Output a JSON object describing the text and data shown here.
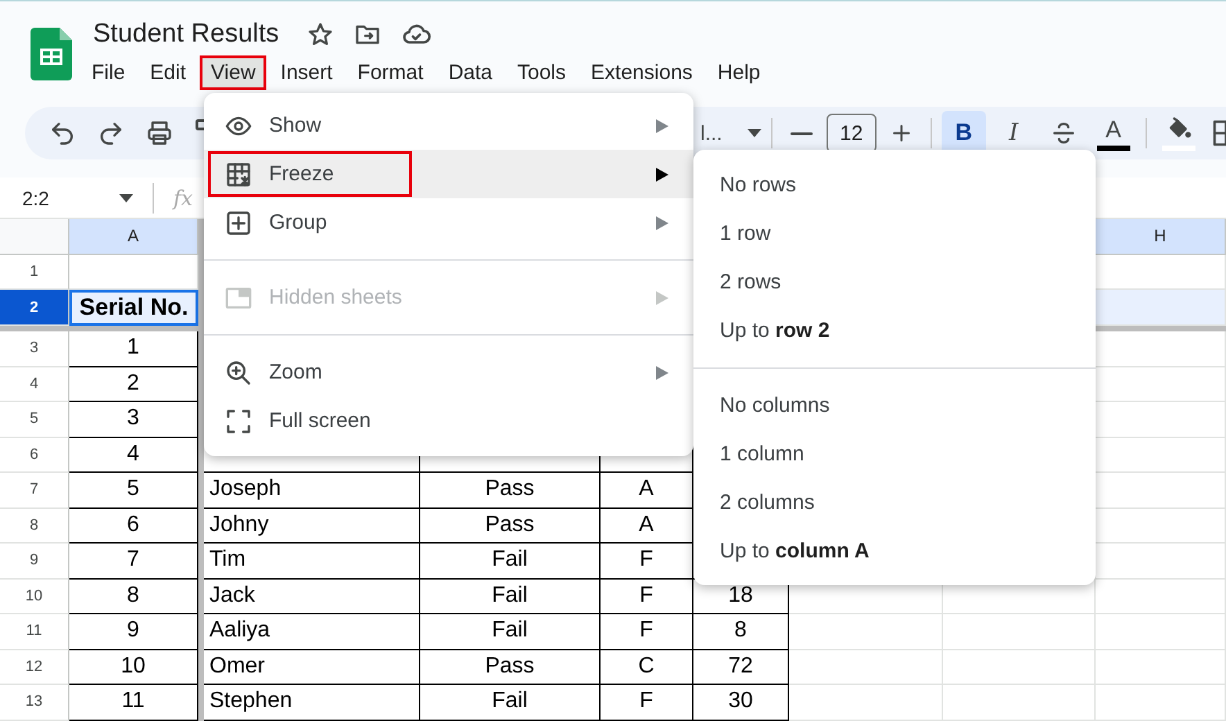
{
  "document": {
    "title": "Student Results"
  },
  "menu_bar": [
    {
      "label": "File",
      "selected": false,
      "outlined": false
    },
    {
      "label": "Edit",
      "selected": false,
      "outlined": false
    },
    {
      "label": "View",
      "selected": true,
      "outlined": true
    },
    {
      "label": "Insert",
      "selected": false,
      "outlined": false
    },
    {
      "label": "Format",
      "selected": false,
      "outlined": false
    },
    {
      "label": "Data",
      "selected": false,
      "outlined": false
    },
    {
      "label": "Tools",
      "selected": false,
      "outlined": false
    },
    {
      "label": "Extensions",
      "selected": false,
      "outlined": false
    },
    {
      "label": "Help",
      "selected": false,
      "outlined": false
    }
  ],
  "toolbar": {
    "font_name": "l...",
    "font_size": "12",
    "format_buttons": [
      {
        "kind": "bold",
        "glyph": "B",
        "selected": true
      },
      {
        "kind": "italic",
        "glyph": "I",
        "selected": false
      },
      {
        "kind": "strikethrough",
        "selected": false
      },
      {
        "kind": "text_color",
        "glyph": "A",
        "selected": false
      }
    ]
  },
  "formula_bar": {
    "name_box": "2:2",
    "formula_icon": "fx"
  },
  "sheet": {
    "columns": [
      {
        "label": "A"
      },
      {
        "label": "H"
      }
    ],
    "rows": [
      {
        "number": "1",
        "selected": false,
        "bordered": false
      },
      {
        "number": "2",
        "selected": true,
        "bordered": false,
        "cells": {
          "A": "Serial No."
        }
      },
      {
        "number": "3",
        "selected": false,
        "bordered": true,
        "cells": {
          "A": "1"
        }
      },
      {
        "number": "4",
        "selected": false,
        "bordered": true,
        "cells": {
          "A": "2"
        }
      },
      {
        "number": "5",
        "selected": false,
        "bordered": true,
        "cells": {
          "A": "3"
        }
      },
      {
        "number": "6",
        "selected": false,
        "bordered": true,
        "cells": {
          "A": "4"
        }
      },
      {
        "number": "7",
        "selected": false,
        "bordered": true,
        "cells": {
          "A": "5",
          "B": "Joseph",
          "C": "Pass",
          "D": "A"
        }
      },
      {
        "number": "8",
        "selected": false,
        "bordered": true,
        "cells": {
          "A": "6",
          "B": "Johny",
          "C": "Pass",
          "D": "A"
        }
      },
      {
        "number": "9",
        "selected": false,
        "bordered": true,
        "cells": {
          "A": "7",
          "B": "Tim",
          "C": "Fail",
          "D": "F"
        }
      },
      {
        "number": "10",
        "selected": false,
        "bordered": true,
        "cells": {
          "A": "8",
          "B": "Jack",
          "C": "Fail",
          "D": "F",
          "E": "18"
        }
      },
      {
        "number": "11",
        "selected": false,
        "bordered": true,
        "cells": {
          "A": "9",
          "B": "Aaliya",
          "C": "Fail",
          "D": "F",
          "E": "8"
        }
      },
      {
        "number": "12",
        "selected": false,
        "bordered": true,
        "cells": {
          "A": "10",
          "B": "Omer",
          "C": "Pass",
          "D": "C",
          "E": "72"
        }
      },
      {
        "number": "13",
        "selected": false,
        "bordered": true,
        "cells": {
          "A": "11",
          "B": "Stephen",
          "C": "Fail",
          "D": "F",
          "E": "30"
        }
      }
    ]
  },
  "view_menu": [
    {
      "kind": "item",
      "label": "Show",
      "selected": false,
      "disabled": false,
      "submenu": true,
      "outlined": false
    },
    {
      "kind": "item",
      "label": "Freeze",
      "selected": true,
      "disabled": false,
      "submenu": true,
      "outlined": true
    },
    {
      "kind": "item",
      "label": "Group",
      "selected": false,
      "disabled": false,
      "submenu": true,
      "outlined": false
    },
    {
      "kind": "divider"
    },
    {
      "kind": "item",
      "label": "Hidden sheets",
      "selected": false,
      "disabled": true,
      "submenu": true,
      "outlined": false
    },
    {
      "kind": "divider"
    },
    {
      "kind": "item",
      "label": "Zoom",
      "selected": false,
      "disabled": false,
      "submenu": true,
      "outlined": false
    },
    {
      "kind": "item",
      "label": "Full screen",
      "selected": false,
      "disabled": false,
      "submenu": false,
      "outlined": false
    }
  ],
  "freeze_submenu": [
    {
      "kind": "item",
      "label": "No rows"
    },
    {
      "kind": "item",
      "label": "1 row"
    },
    {
      "kind": "item",
      "label": "2 rows"
    },
    {
      "kind": "item",
      "label": "Up to **row 2**"
    },
    {
      "kind": "divider"
    },
    {
      "kind": "item",
      "label": "No columns"
    },
    {
      "kind": "item",
      "label": "1 column"
    },
    {
      "kind": "item",
      "label": "2 columns"
    },
    {
      "kind": "item",
      "label": "Up to **column A**"
    }
  ]
}
